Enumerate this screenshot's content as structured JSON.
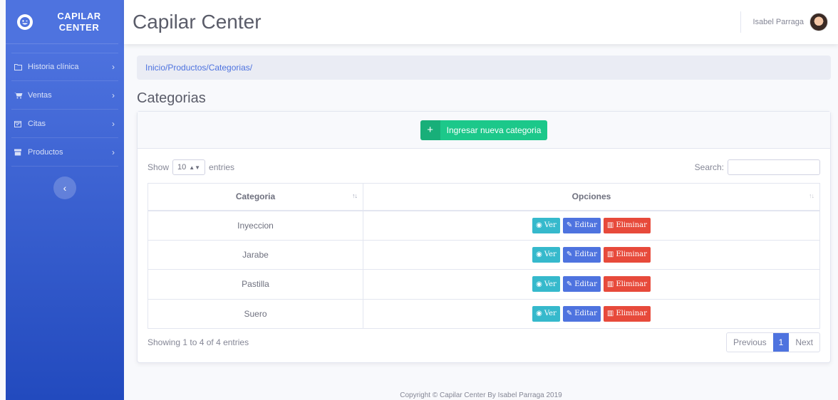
{
  "brand": {
    "line1": "CAPILAR",
    "line2": "CENTER"
  },
  "sidebar": {
    "items": [
      {
        "label": "Historia clínica",
        "icon": "folder-icon"
      },
      {
        "label": "Ventas",
        "icon": "cart-icon"
      },
      {
        "label": "Citas",
        "icon": "calendar-icon"
      },
      {
        "label": "Productos",
        "icon": "box-icon"
      }
    ],
    "toggle_icon": "chevron-left-icon"
  },
  "topbar": {
    "title": "Capilar Center",
    "user_name": "Isabel Parraga"
  },
  "breadcrumb": "Inicio/Productos/Categorias/",
  "page_title": "Categorias",
  "add_button": "Ingresar nueva categoria",
  "datatable": {
    "show_label": "Show",
    "length_value": "10",
    "entries_label": "entries",
    "search_label": "Search:",
    "columns": [
      "Categoria",
      "Opciones"
    ],
    "rows": [
      {
        "categoria": "Inyeccion"
      },
      {
        "categoria": "Jarabe"
      },
      {
        "categoria": "Pastilla"
      },
      {
        "categoria": "Suero"
      }
    ],
    "actions": {
      "ver": "Ver",
      "editar": "Editar",
      "eliminar": "Eliminar"
    },
    "info": "Showing 1 to 4 of 4 entries",
    "pager": {
      "previous": "Previous",
      "page": "1",
      "next": "Next"
    }
  },
  "footer": "Copyright © Capilar Center By Isabel Parraga 2019",
  "colors": {
    "primary": "#4e73df",
    "success": "#1cc88a",
    "info": "#36b9cc",
    "danger": "#e74a3b"
  }
}
